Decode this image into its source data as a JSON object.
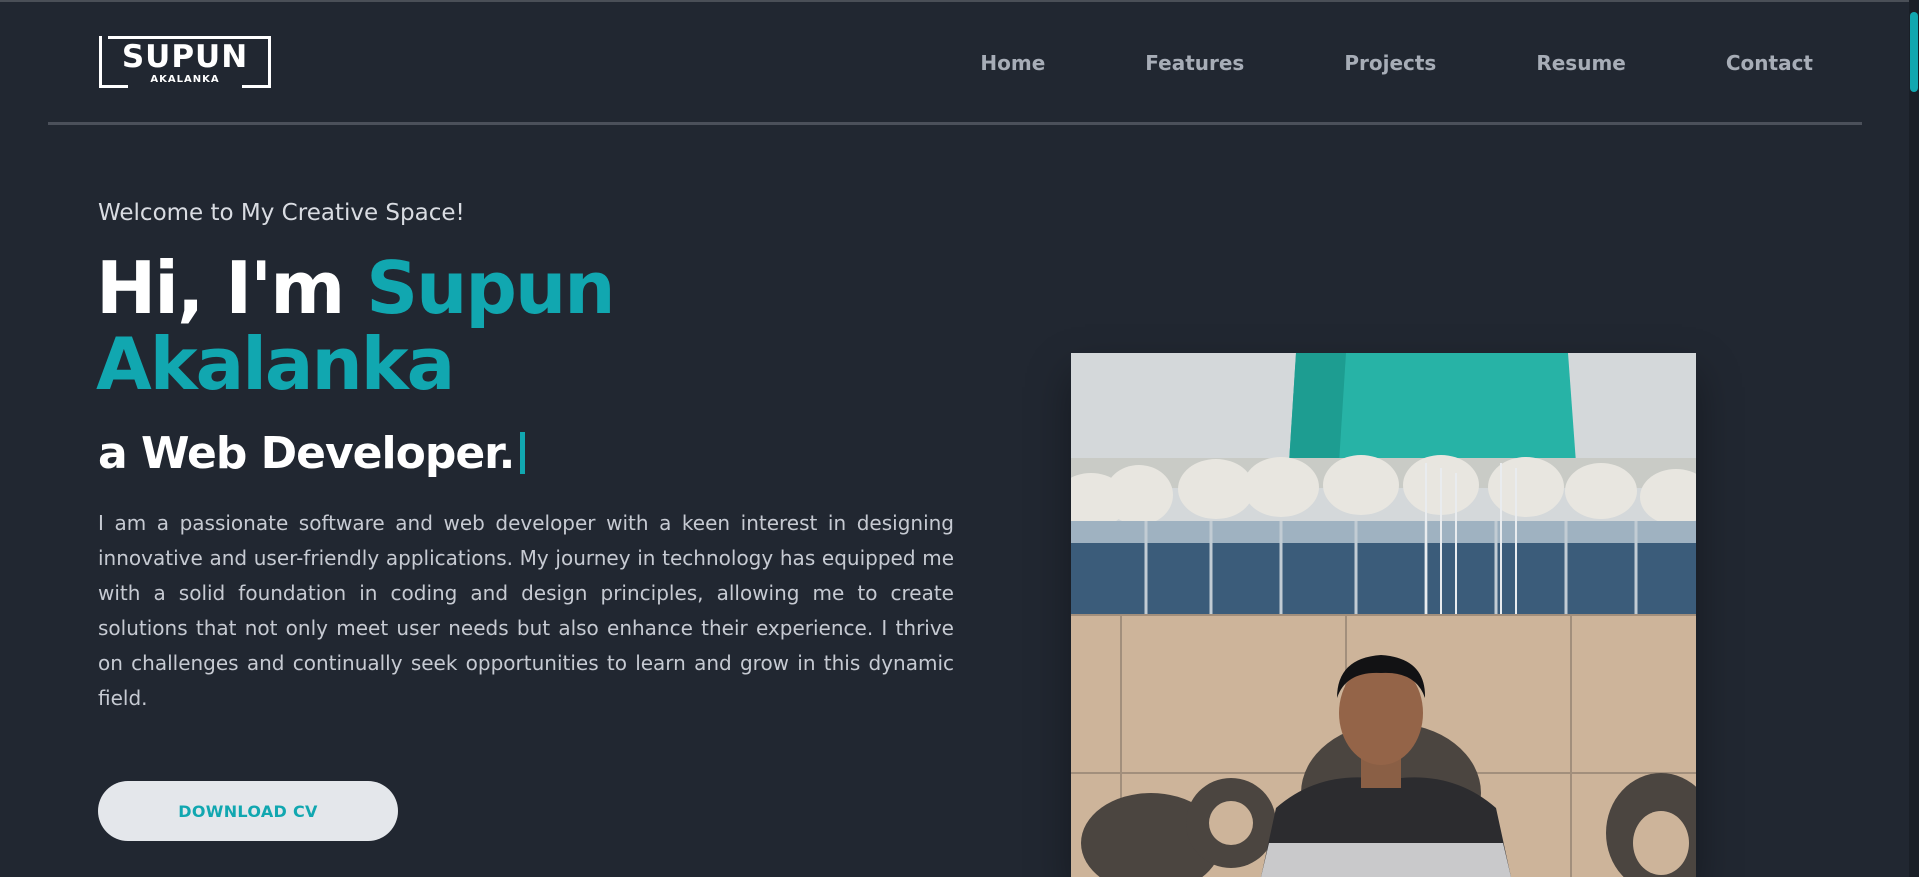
{
  "header": {
    "logo": {
      "name": "SUPUN",
      "surname": "AKALANKA"
    },
    "nav": [
      {
        "label": "Home"
      },
      {
        "label": "Features"
      },
      {
        "label": "Projects"
      },
      {
        "label": "Resume"
      },
      {
        "label": "Contact"
      }
    ]
  },
  "hero": {
    "welcome": "Welcome to My Creative Space!",
    "greeting": "Hi, I'm",
    "first_name": "Supun",
    "last_name": "Akalanka",
    "role": "a Web Developer.",
    "bio": "I am a passionate software and web developer with a keen interest in designing innovative and user-friendly applications. My journey in technology has equipped me with a solid foundation in coding and design principles, allowing me to create solutions that not only meet user needs but also enhance their experience. I thrive on challenges and continually seek opportunities to learn and grow in this dynamic field.",
    "cv_button": "DOWNLOAD CV"
  },
  "colors": {
    "background": "#212731",
    "accent": "#11a7b0",
    "nav_text": "#a7adb7",
    "button_bg": "#e4e7eb"
  }
}
